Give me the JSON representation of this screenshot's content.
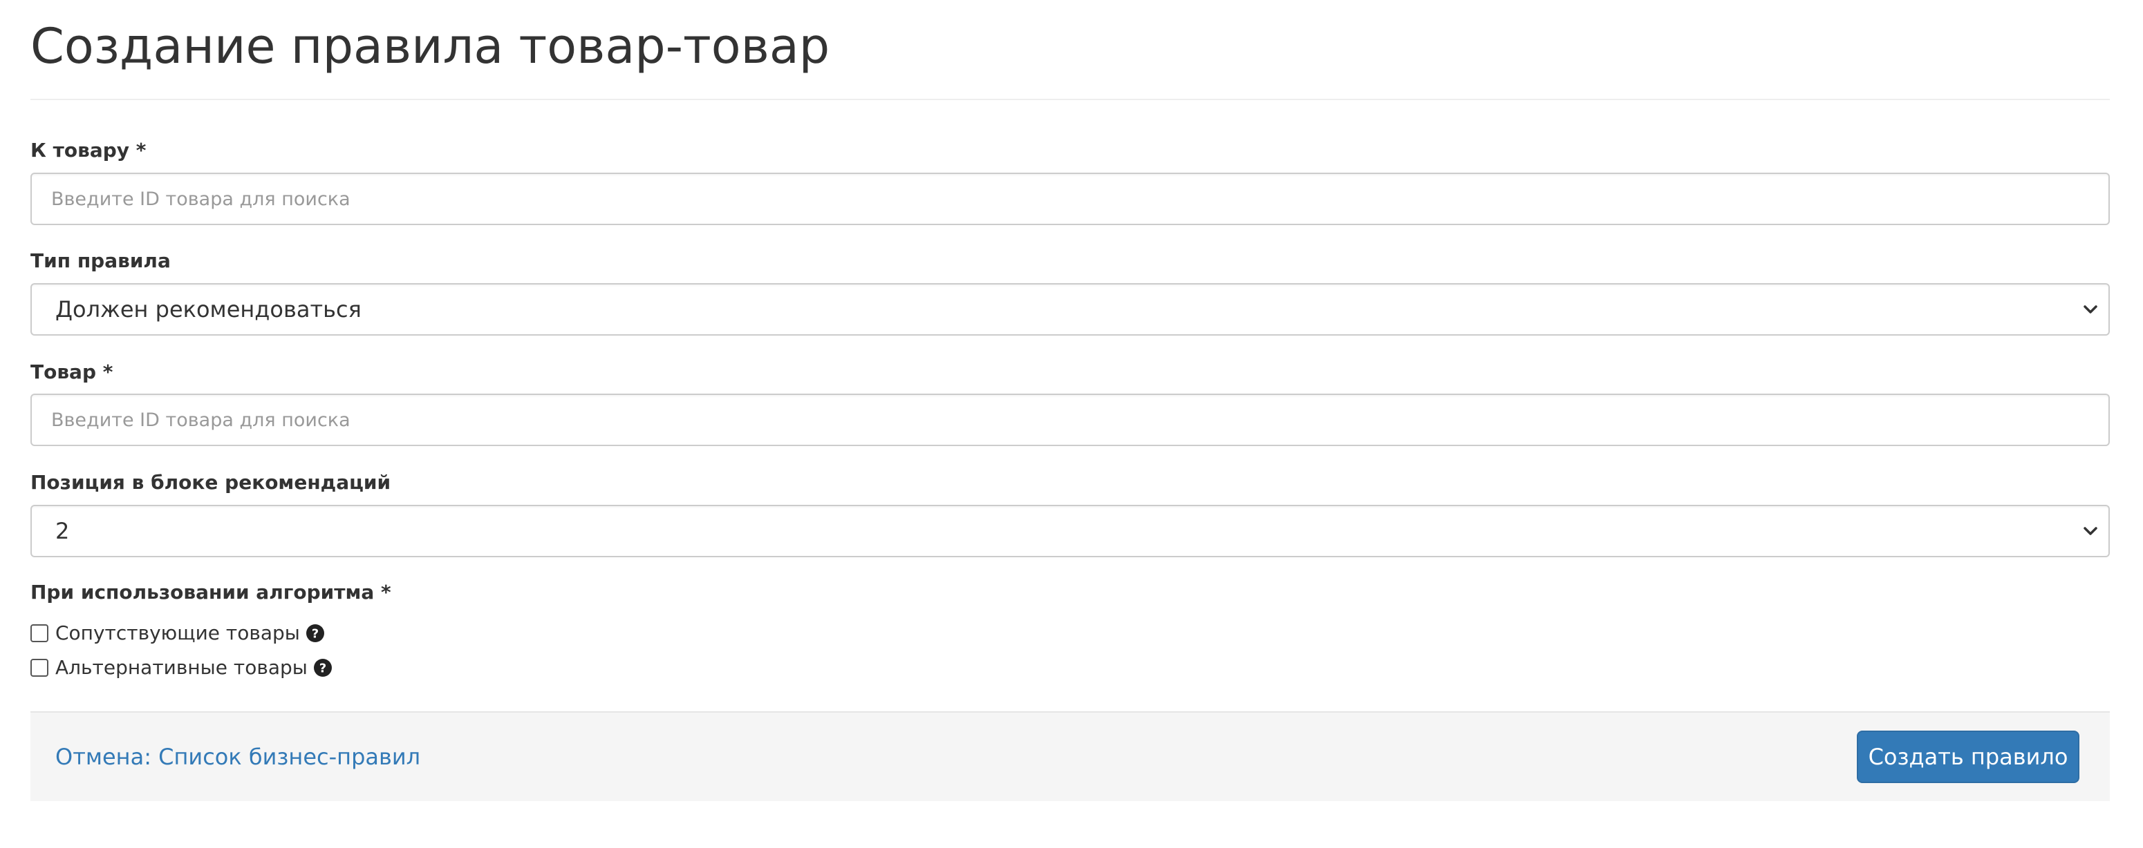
{
  "page": {
    "title": "Создание правила товар-товар"
  },
  "form": {
    "to_product": {
      "label": "К товару *",
      "value": "",
      "placeholder": "Введите ID товара для поиска"
    },
    "rule_type": {
      "label": "Тип правила",
      "selected": "Должен рекомендоваться",
      "icon": "chevron-down-icon"
    },
    "product": {
      "label": "Товар *",
      "value": "",
      "placeholder": "Введите ID товара для поиска"
    },
    "position": {
      "label": "Позиция в блоке рекомендаций",
      "selected": "2",
      "icon": "chevron-down-icon"
    },
    "algorithm": {
      "label": "При использовании алгоритма *",
      "options": [
        {
          "label": "Сопутствующие товары",
          "checked": false,
          "icon": "question-circle-icon"
        },
        {
          "label": "Альтернативные товары",
          "checked": false,
          "icon": "question-circle-icon"
        }
      ]
    }
  },
  "footer": {
    "cancel_label": "Отмена: Список бизнес-правил",
    "submit_label": "Создать правило"
  },
  "colors": {
    "link": "#337ab7",
    "primary_button": "#337ab7",
    "footer_background": "#f5f5f5",
    "input_border": "#cccccc",
    "text": "#333333"
  }
}
